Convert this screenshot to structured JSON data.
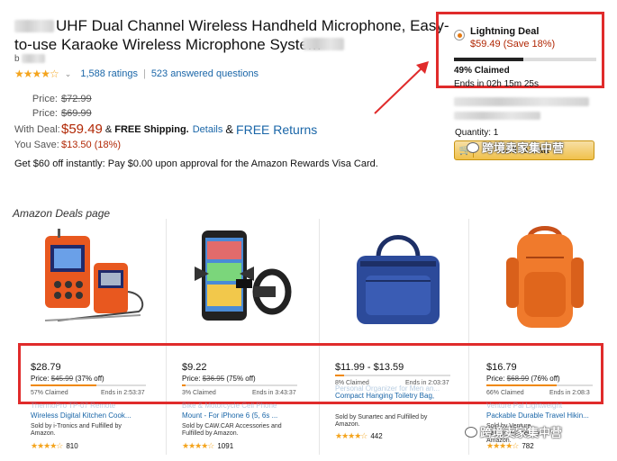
{
  "product": {
    "title_line1": "UHF Dual Channel Wireless Handheld Microphone, Easy-",
    "title_line2": "to-use Karaoke Wireless Microphone System",
    "by_prefix": "b",
    "stars": "★★★★☆",
    "ratings": "1,588 ratings",
    "separator": "|",
    "answered": "523 answered questions"
  },
  "prices": {
    "price_label": "Price:",
    "price1": "$72.99",
    "price2": "$69.99",
    "with_deal_label": "With Deal:",
    "deal_price": "$59.49",
    "free_shipping_prefix": "&",
    "free_shipping": "FREE Shipping.",
    "details": "Details",
    "returns_prefix": "&",
    "free_returns": "FREE Returns",
    "you_save_label": "You Save:",
    "you_save": "$13.50 (18%)"
  },
  "visa_offer": "Get $60 off instantly: Pay $0.00 upon approval for the Amazon Rewards Visa Card.",
  "lightning_deal": {
    "title": "Lightning Deal",
    "price": "$59.49 (Save 18%)",
    "claimed_pct": 0.49,
    "claimed": "49% Claimed",
    "ends": "Ends in 02h 15m 25s"
  },
  "buy_box": {
    "quantity": "Quantity: 1",
    "cart_button": "Add to Cart"
  },
  "watermark": "跨境卖家集中营",
  "deals": {
    "heading": "Amazon Deals page",
    "cards": [
      {
        "price": "$28.79",
        "price_label": "Price:",
        "list_price": "$45.99",
        "pct_off": "(37% off)",
        "claimed_pct": 0.57,
        "claimed": "57% Claimed",
        "ends": "Ends in 2:53:37",
        "hidden_line": "ThermoPro TP-07 Remote",
        "name": "Wireless Digital Kitchen Cook...",
        "sold_by": "Sold by i-Tronics and Fulfilled by Amazon.",
        "stars": "★★★★☆",
        "reviews": "810"
      },
      {
        "price": "$9.22",
        "price_label": "Price:",
        "list_price": "$36.95",
        "pct_off": "(75% off)",
        "claimed_pct": 0.03,
        "claimed": "3% Claimed",
        "ends": "Ends in 3:43:37",
        "hidden_line": "Bike & Motorcycle Cell Phone",
        "name": "Mount - For iPhone 6 (5, 6s ...",
        "sold_by": "Sold by CAW.CAR Accessories and Fulfilled by Amazon.",
        "stars": "★★★★☆",
        "reviews": "1091"
      },
      {
        "price": "$11.99 - $13.59",
        "price_label": "",
        "list_price": "",
        "pct_off": "",
        "claimed_pct": 0.08,
        "claimed": "8% Claimed",
        "ends": "Ends in 2:03:37",
        "hidden_line": "Personal Organizer for Men an...",
        "name": "Compact Hanging Toiletry Bag,",
        "sold_by": "Sold by Sunartec and Fulfilled by Amazon.",
        "stars": "★★★★☆",
        "reviews": "442"
      },
      {
        "price": "$16.79",
        "price_label": "Price:",
        "list_price": "$68.99",
        "pct_off": "(76% off)",
        "claimed_pct": 0.66,
        "claimed": "66% Claimed",
        "ends": "Ends in 2:08:3",
        "hidden_line": "Venture Pal Lightweight",
        "name": "Packable Durable Travel Hikin...",
        "sold_by": "Sold by Venture Pal and Fulfilled by Amazon.",
        "stars": "★★★★☆",
        "reviews": "782"
      }
    ]
  },
  "colors": {
    "highlight": "#e02b2b",
    "deal_red": "#b12704",
    "link_blue": "#1a66a8",
    "star_orange": "#f4a41d",
    "claim_orange": "#f08804"
  }
}
